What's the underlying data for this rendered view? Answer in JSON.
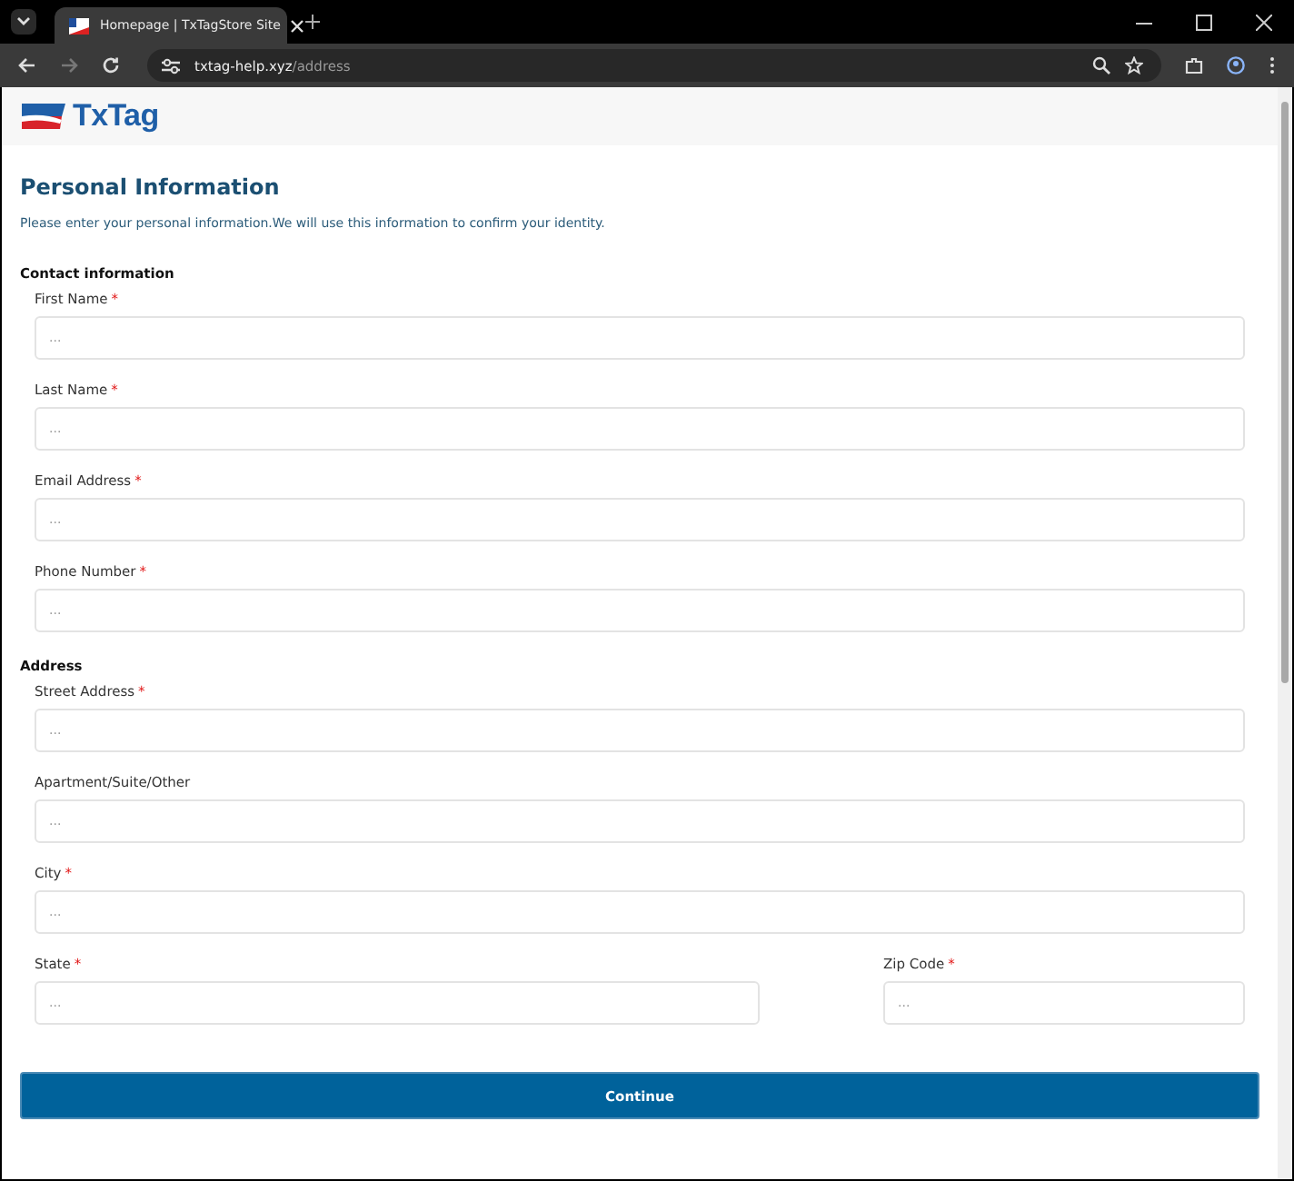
{
  "browser": {
    "tab_title": "Homepage | TxTagStore Site",
    "url_host": "txtag-help.xyz",
    "url_path": "/address"
  },
  "logo": {
    "text": "TxTag"
  },
  "heading": "Personal Information",
  "intro": "Please enter your personal information.We will use this information to confirm your identity.",
  "sections": [
    {
      "title": "Contact information",
      "fields": [
        {
          "label": "First Name",
          "required": true,
          "placeholder": "..."
        },
        {
          "label": "Last Name",
          "required": true,
          "placeholder": "..."
        },
        {
          "label": "Email Address",
          "required": true,
          "placeholder": "..."
        },
        {
          "label": "Phone Number",
          "required": true,
          "placeholder": "..."
        }
      ]
    },
    {
      "title": "Address",
      "fields": [
        {
          "label": "Street Address",
          "required": true,
          "placeholder": "..."
        },
        {
          "label": "Apartment/Suite/Other",
          "required": false,
          "placeholder": "..."
        },
        {
          "label": "City",
          "required": true,
          "placeholder": "..."
        }
      ]
    }
  ],
  "row_fields": [
    {
      "label": "State",
      "required": true,
      "placeholder": "..."
    },
    {
      "label": "Zip Code",
      "required": true,
      "placeholder": "..."
    }
  ],
  "required_mark": "*",
  "continue_button": "Continue"
}
